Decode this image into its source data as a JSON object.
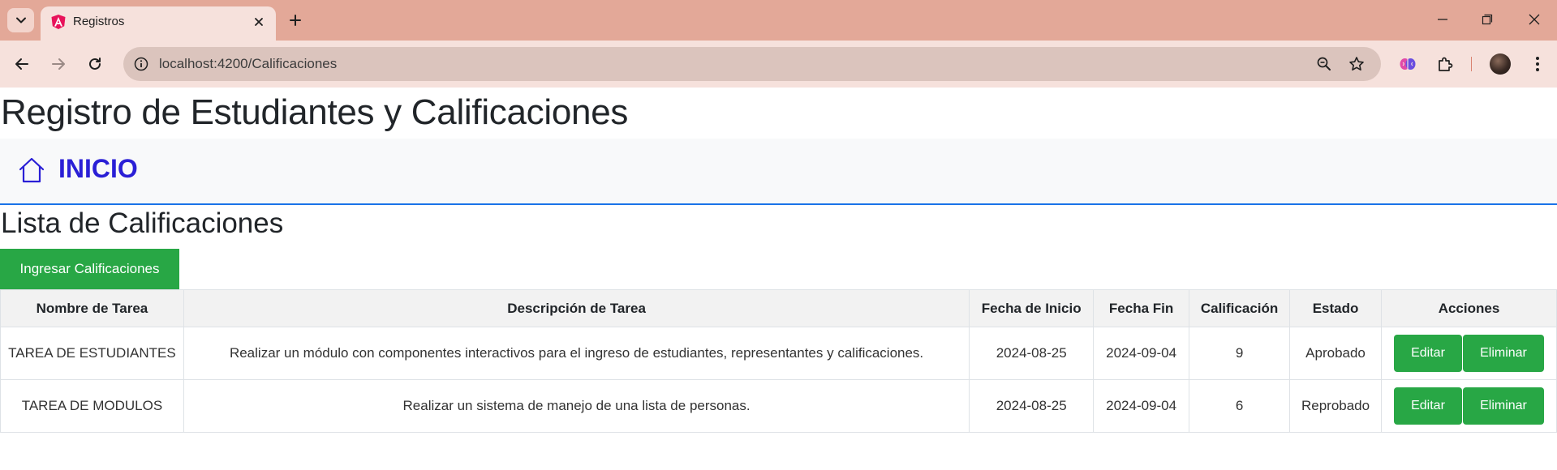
{
  "browser": {
    "tab_title": "Registros",
    "url": "localhost:4200/Calificaciones"
  },
  "page": {
    "title": "Registro de Estudiantes y Calificaciones",
    "nav_link": "INICIO",
    "section_title": "Lista de Calificaciones",
    "add_button": "Ingresar Calificaciones"
  },
  "table": {
    "headers": [
      "Nombre de Tarea",
      "Descripción de Tarea",
      "Fecha de Inicio",
      "Fecha Fin",
      "Calificación",
      "Estado",
      "Acciones"
    ],
    "rows": [
      {
        "name": "TAREA DE ESTUDIANTES",
        "description": "Realizar un módulo con componentes interactivos para el ingreso de estudiantes, representantes y calificaciones.",
        "start": "2024-08-25",
        "end": "2024-09-04",
        "grade": "9",
        "status": "Aprobado",
        "edit": "Editar",
        "delete": "Eliminar"
      },
      {
        "name": "TAREA DE MODULOS",
        "description": "Realizar un sistema de manejo de una lista de personas.",
        "start": "2024-08-25",
        "end": "2024-09-04",
        "grade": "6",
        "status": "Reprobado",
        "edit": "Editar",
        "delete": "Eliminar"
      }
    ]
  }
}
